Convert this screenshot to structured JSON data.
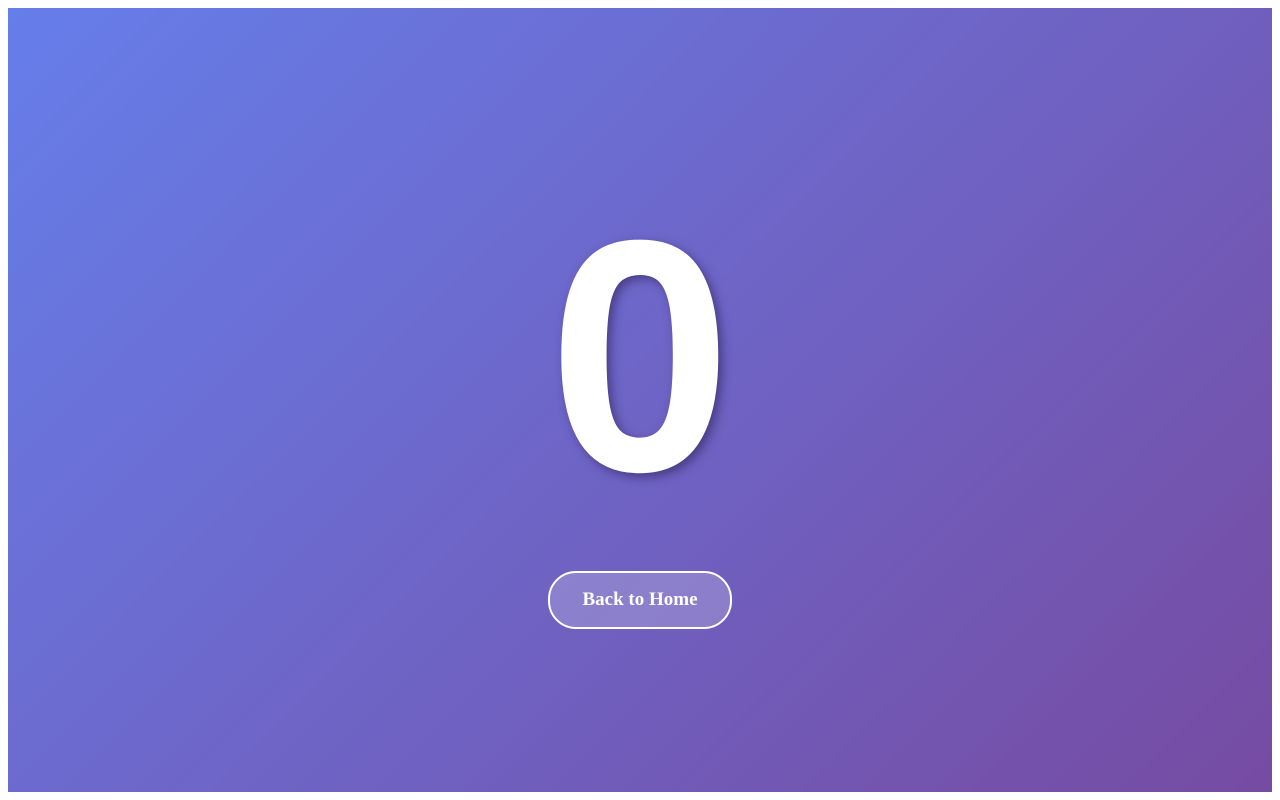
{
  "hero": {
    "glyph": "0"
  },
  "actions": {
    "back_home_label": "Back to Home"
  },
  "colors": {
    "gradient_start": "#667eea",
    "gradient_end": "#764ba2",
    "text": "#ffffff"
  }
}
